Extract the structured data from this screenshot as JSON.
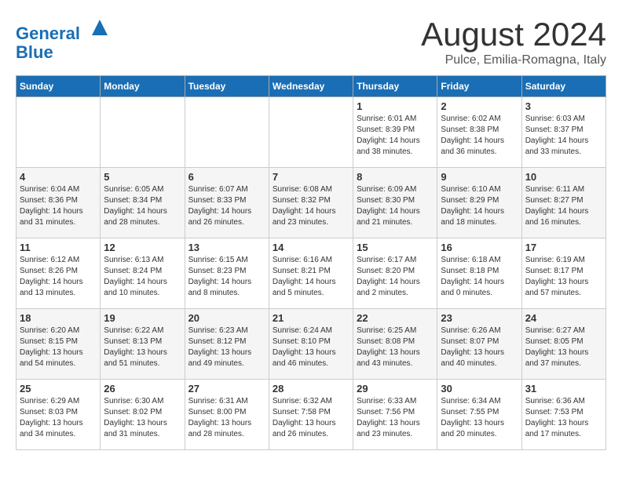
{
  "logo": {
    "line1": "General",
    "line2": "Blue"
  },
  "title": "August 2024",
  "location": "Pulce, Emilia-Romagna, Italy",
  "days_of_week": [
    "Sunday",
    "Monday",
    "Tuesday",
    "Wednesday",
    "Thursday",
    "Friday",
    "Saturday"
  ],
  "weeks": [
    [
      {
        "day": "",
        "info": ""
      },
      {
        "day": "",
        "info": ""
      },
      {
        "day": "",
        "info": ""
      },
      {
        "day": "",
        "info": ""
      },
      {
        "day": "1",
        "info": "Sunrise: 6:01 AM\nSunset: 8:39 PM\nDaylight: 14 hours\nand 38 minutes."
      },
      {
        "day": "2",
        "info": "Sunrise: 6:02 AM\nSunset: 8:38 PM\nDaylight: 14 hours\nand 36 minutes."
      },
      {
        "day": "3",
        "info": "Sunrise: 6:03 AM\nSunset: 8:37 PM\nDaylight: 14 hours\nand 33 minutes."
      }
    ],
    [
      {
        "day": "4",
        "info": "Sunrise: 6:04 AM\nSunset: 8:36 PM\nDaylight: 14 hours\nand 31 minutes."
      },
      {
        "day": "5",
        "info": "Sunrise: 6:05 AM\nSunset: 8:34 PM\nDaylight: 14 hours\nand 28 minutes."
      },
      {
        "day": "6",
        "info": "Sunrise: 6:07 AM\nSunset: 8:33 PM\nDaylight: 14 hours\nand 26 minutes."
      },
      {
        "day": "7",
        "info": "Sunrise: 6:08 AM\nSunset: 8:32 PM\nDaylight: 14 hours\nand 23 minutes."
      },
      {
        "day": "8",
        "info": "Sunrise: 6:09 AM\nSunset: 8:30 PM\nDaylight: 14 hours\nand 21 minutes."
      },
      {
        "day": "9",
        "info": "Sunrise: 6:10 AM\nSunset: 8:29 PM\nDaylight: 14 hours\nand 18 minutes."
      },
      {
        "day": "10",
        "info": "Sunrise: 6:11 AM\nSunset: 8:27 PM\nDaylight: 14 hours\nand 16 minutes."
      }
    ],
    [
      {
        "day": "11",
        "info": "Sunrise: 6:12 AM\nSunset: 8:26 PM\nDaylight: 14 hours\nand 13 minutes."
      },
      {
        "day": "12",
        "info": "Sunrise: 6:13 AM\nSunset: 8:24 PM\nDaylight: 14 hours\nand 10 minutes."
      },
      {
        "day": "13",
        "info": "Sunrise: 6:15 AM\nSunset: 8:23 PM\nDaylight: 14 hours\nand 8 minutes."
      },
      {
        "day": "14",
        "info": "Sunrise: 6:16 AM\nSunset: 8:21 PM\nDaylight: 14 hours\nand 5 minutes."
      },
      {
        "day": "15",
        "info": "Sunrise: 6:17 AM\nSunset: 8:20 PM\nDaylight: 14 hours\nand 2 minutes."
      },
      {
        "day": "16",
        "info": "Sunrise: 6:18 AM\nSunset: 8:18 PM\nDaylight: 14 hours\nand 0 minutes."
      },
      {
        "day": "17",
        "info": "Sunrise: 6:19 AM\nSunset: 8:17 PM\nDaylight: 13 hours\nand 57 minutes."
      }
    ],
    [
      {
        "day": "18",
        "info": "Sunrise: 6:20 AM\nSunset: 8:15 PM\nDaylight: 13 hours\nand 54 minutes."
      },
      {
        "day": "19",
        "info": "Sunrise: 6:22 AM\nSunset: 8:13 PM\nDaylight: 13 hours\nand 51 minutes."
      },
      {
        "day": "20",
        "info": "Sunrise: 6:23 AM\nSunset: 8:12 PM\nDaylight: 13 hours\nand 49 minutes."
      },
      {
        "day": "21",
        "info": "Sunrise: 6:24 AM\nSunset: 8:10 PM\nDaylight: 13 hours\nand 46 minutes."
      },
      {
        "day": "22",
        "info": "Sunrise: 6:25 AM\nSunset: 8:08 PM\nDaylight: 13 hours\nand 43 minutes."
      },
      {
        "day": "23",
        "info": "Sunrise: 6:26 AM\nSunset: 8:07 PM\nDaylight: 13 hours\nand 40 minutes."
      },
      {
        "day": "24",
        "info": "Sunrise: 6:27 AM\nSunset: 8:05 PM\nDaylight: 13 hours\nand 37 minutes."
      }
    ],
    [
      {
        "day": "25",
        "info": "Sunrise: 6:29 AM\nSunset: 8:03 PM\nDaylight: 13 hours\nand 34 minutes."
      },
      {
        "day": "26",
        "info": "Sunrise: 6:30 AM\nSunset: 8:02 PM\nDaylight: 13 hours\nand 31 minutes."
      },
      {
        "day": "27",
        "info": "Sunrise: 6:31 AM\nSunset: 8:00 PM\nDaylight: 13 hours\nand 28 minutes."
      },
      {
        "day": "28",
        "info": "Sunrise: 6:32 AM\nSunset: 7:58 PM\nDaylight: 13 hours\nand 26 minutes."
      },
      {
        "day": "29",
        "info": "Sunrise: 6:33 AM\nSunset: 7:56 PM\nDaylight: 13 hours\nand 23 minutes."
      },
      {
        "day": "30",
        "info": "Sunrise: 6:34 AM\nSunset: 7:55 PM\nDaylight: 13 hours\nand 20 minutes."
      },
      {
        "day": "31",
        "info": "Sunrise: 6:36 AM\nSunset: 7:53 PM\nDaylight: 13 hours\nand 17 minutes."
      }
    ]
  ]
}
